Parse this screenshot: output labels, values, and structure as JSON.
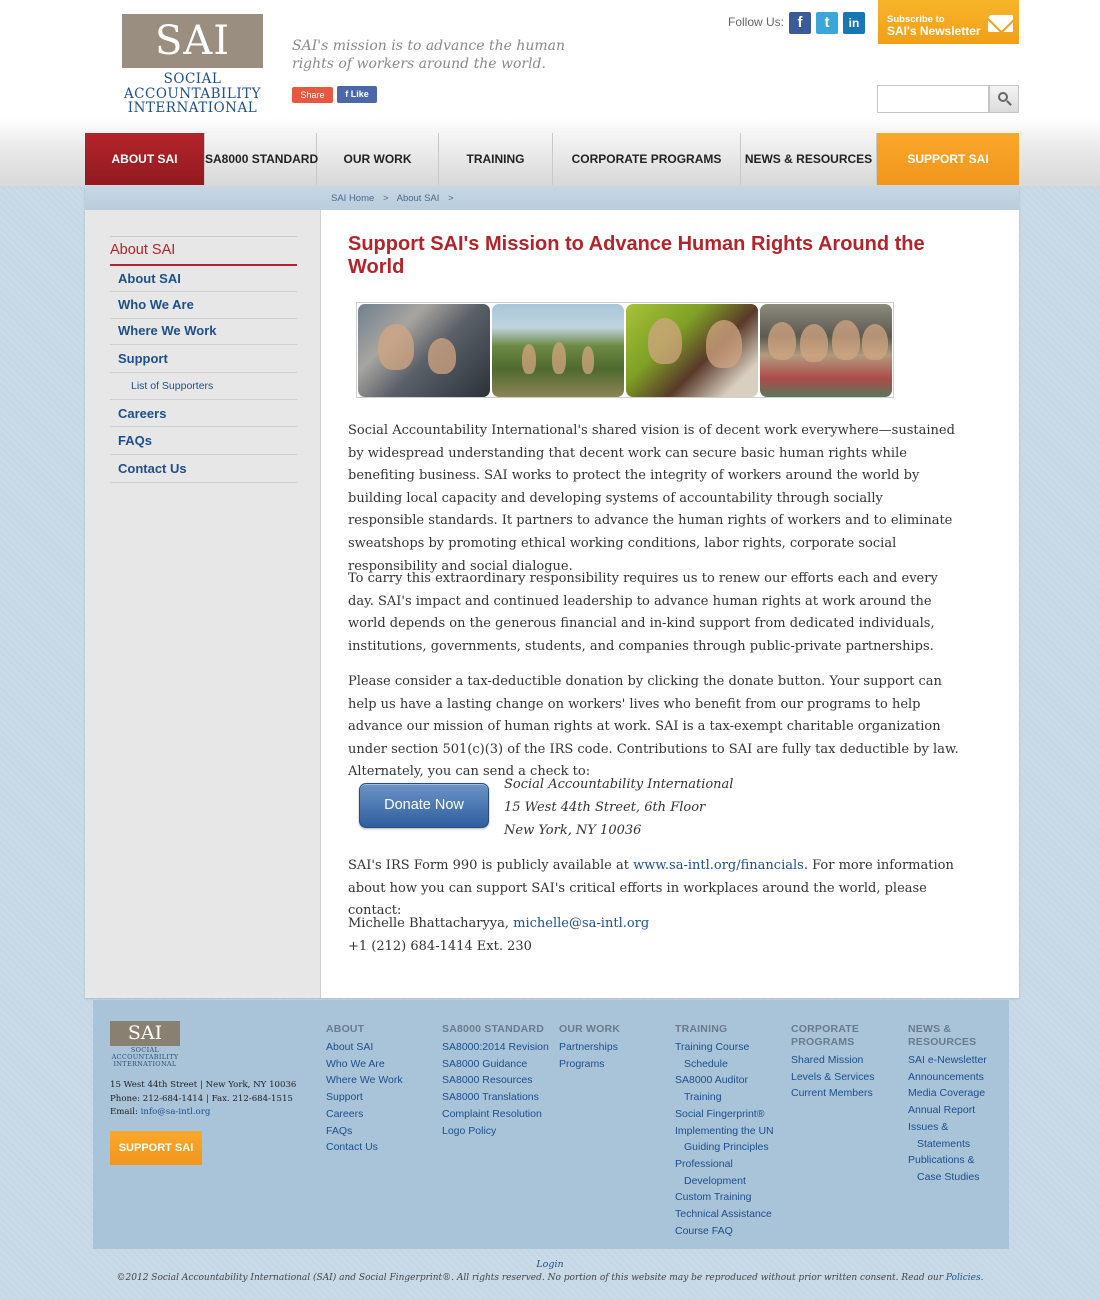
{
  "header": {
    "logo_text": "SAI",
    "logo_sub": [
      "SOCIAL",
      "ACCOUNTABILITY",
      "INTERNATIONAL"
    ],
    "mission": "SAI's mission is to advance the human rights of workers around the world.",
    "share_label": "Share",
    "like_label": "Like",
    "follow_label": "Follow Us:",
    "social_icons": [
      "facebook-icon",
      "twitter-icon",
      "linkedin-icon"
    ],
    "newsletter_line1": "Subscribe to",
    "newsletter_line2": "SAI's Newsletter",
    "search_placeholder": ""
  },
  "nav": {
    "items": [
      "ABOUT SAI",
      "SA8000 STANDARD",
      "OUR WORK",
      "TRAINING",
      "CORPORATE PROGRAMS",
      "NEWS & RESOURCES",
      "SUPPORT SAI"
    ],
    "active": "ABOUT SAI"
  },
  "breadcrumb": [
    "SAI Home",
    ">",
    "About SAI",
    ">"
  ],
  "sidebar": {
    "heading": "About SAI",
    "items": [
      "About SAI",
      "Who We Are",
      "Where We Work",
      "Support",
      "List of Supporters",
      "Careers",
      "FAQs",
      "Contact Us"
    ]
  },
  "main": {
    "title": "Support SAI's Mission to Advance Human Rights Around the World",
    "paragraphs": [
      "Social Accountability International's shared vision is of decent work everywhere—sustained by widespread understanding that decent work can secure basic human rights while benefiting business. SAI works to protect the integrity of workers around the world by building local capacity and developing systems of accountability through socially responsible standards. It partners to advance the human rights of workers and to eliminate sweatshops by promoting ethical working conditions, labor rights, corporate social responsibility and social dialogue.",
      "To carry this extraordinary responsibility requires us to renew our efforts each and every day. SAI's impact and continued leadership to advance human rights at work around the world depends on the generous financial and in-kind support from dedicated individuals, institutions, governments, students, and companies through public-private partnerships.",
      "Please consider a tax-deductible donation by clicking the donate button. Your support can help us have a lasting change on workers' lives who benefit from our programs to help advance our mission of human rights at work. SAI is a tax-exempt charitable organization under section 501(c)(3) of the IRS code. Contributions to SAI are fully tax deductible by law. Alternately, you can send a check to:"
    ],
    "donate_label": "Donate Now",
    "address": [
      "Social Accountability International",
      "15 West 44th Street, 6th Floor",
      "New York, NY 10036"
    ],
    "irs_before": "SAI's IRS Form 990 is publicly available at ",
    "irs_link": "www.sa-intl.org/financials",
    "irs_after": ". For more information about how you can support SAI's critical efforts in workplaces around the world, please contact:",
    "contact_name": "Michelle Bhattacharyya, ",
    "contact_email": "michelle@sa-intl.org",
    "contact_phone": "+1 (212) 684-1414 Ext. 230"
  },
  "footer": {
    "logo_text": "SAI",
    "logo_sub": [
      "SOCIAL",
      "ACCOUNTABILITY",
      "INTERNATIONAL"
    ],
    "address_line": "15 West 44th Street | New York, NY 10036",
    "phone_line": "Phone: 212-684-1414 | Fax. 212-684-1515",
    "email_prefix": "Email: ",
    "email": "info@sa-intl.org",
    "support_label": "SUPPORT SAI",
    "columns": {
      "about": {
        "head": "ABOUT",
        "links": [
          "About SAI",
          "Who We Are",
          "Where We Work",
          "Support",
          "Careers",
          "FAQs",
          "Contact Us"
        ]
      },
      "sa8000": {
        "head": "SA8000 STANDARD",
        "links": [
          "SA8000:2014 Revision",
          "SA8000 Guidance",
          "SA8000 Resources",
          "SA8000 Translations",
          "Complaint Resolution",
          "Logo Policy"
        ]
      },
      "ourwork": {
        "head": "OUR WORK",
        "links": [
          "Partnerships",
          "Programs"
        ]
      },
      "training": {
        "head": "TRAINING",
        "links": [
          "Training Course",
          "Schedule",
          "SA8000 Auditor",
          "Training",
          "Social Fingerprint®",
          "Implementing the UN",
          "Guiding Principles",
          "Professional",
          "Development",
          "Custom Training",
          "Technical Assistance",
          "Course FAQ"
        ]
      },
      "corporate": {
        "head": [
          "CORPORATE",
          "PROGRAMS"
        ],
        "links": [
          "Shared Mission",
          "Levels & Services",
          "Current Members"
        ]
      },
      "news": {
        "head": [
          "NEWS &",
          "RESOURCES"
        ],
        "links": [
          "SAI e-Newsletter",
          "Announcements",
          "Media Coverage",
          "Annual Report",
          "Issues &",
          "Statements",
          "Publications &",
          "Case Studies"
        ]
      }
    },
    "login": "Login",
    "copyright": "©2012 Social Accountability International (SAI) and Social Fingerprint®. All rights reserved. No portion of this website may be reproduced without prior written consent. Read our ",
    "policies": "Policies",
    "copyright_end": "."
  },
  "colors": {
    "brand_red": "#b3242a",
    "brand_blue": "#1d4f8c",
    "accent_orange": "#f29f17",
    "footer_blue": "#a9c3d9"
  }
}
